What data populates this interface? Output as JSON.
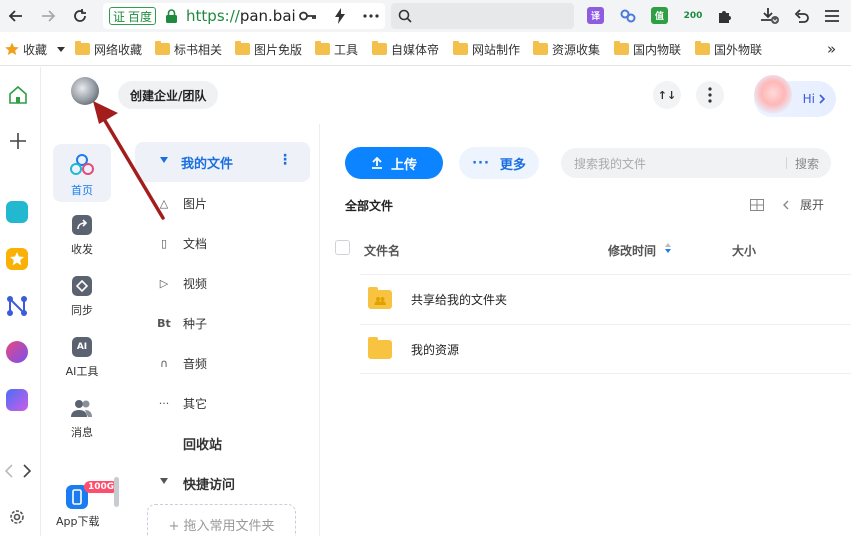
{
  "browser": {
    "url_badge": "证",
    "url_badge_site": "百度",
    "url_scheme": "https://",
    "url_host": "pan.bai",
    "ext_translate": "译",
    "ext_green": "值",
    "ext_200": "200"
  },
  "bookmarks": {
    "favorites": "收藏",
    "items": [
      "网络收藏",
      "标书相关",
      "图片免版",
      "工具",
      "自媒体帝",
      "网站制作",
      "资源收集",
      "国内物联",
      "国外物联"
    ],
    "overflow": "»"
  },
  "app": {
    "nav": [
      {
        "label": "首页"
      },
      {
        "label": "收发"
      },
      {
        "label": "同步"
      },
      {
        "label": "AI工具"
      },
      {
        "label": "消息"
      }
    ],
    "ai_icon_text": "AI",
    "download_label": "App下载",
    "download_badge": "100G"
  },
  "header": {
    "team_button": "创建企业/团队",
    "hi_label": "Hi",
    "sort_icon_text": "↑↓"
  },
  "tree": {
    "root": "我的文件",
    "items": [
      {
        "label": "图片",
        "icon_text": "△"
      },
      {
        "label": "文档",
        "icon_text": "▯"
      },
      {
        "label": "视频",
        "icon_text": "▷"
      },
      {
        "label": "种子",
        "icon_text": "Bt"
      },
      {
        "label": "音频",
        "icon_text": "∩"
      },
      {
        "label": "其它",
        "icon_text": "···"
      }
    ],
    "recycle": "回收站",
    "quick_access": "快捷访问",
    "drop_zone": "+ 拖入常用文件夹"
  },
  "main": {
    "upload": "上传",
    "more": "更多",
    "search_placeholder": "搜索我的文件",
    "search_button": "搜索",
    "all_files": "全部文件",
    "expand": "展开",
    "col_name": "文件名",
    "col_modified": "修改时间",
    "col_size": "大小",
    "rows": [
      {
        "name": "共享给我的文件夹"
      },
      {
        "name": "我的资源"
      }
    ]
  },
  "colors": {
    "accent": "#0d84ff",
    "folder": "#f8c340",
    "annotation_arrow": "#a31d1d"
  }
}
